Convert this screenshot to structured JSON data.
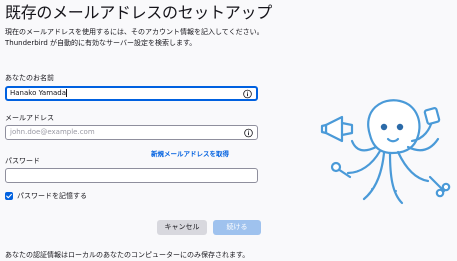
{
  "page": {
    "title": "既存のメールアドレスのセットアップ",
    "description_line1": "現在のメールアドレスを使用するには、そのアカウント情報を記入してください。",
    "description_line2": "Thunderbird が自動的に有効なサーバー設定を検索します。"
  },
  "form": {
    "name_label": "あなたのお名前",
    "name_value": "Hanako Yamada",
    "email_label": "メールアドレス",
    "email_placeholder": "john.doe@example.com",
    "get_new_email_link": "新規メールアドレスを取得",
    "password_label": "パスワード",
    "remember_password_label": "パスワードを記憶する",
    "remember_password_checked": true
  },
  "buttons": {
    "cancel": "キャンセル",
    "continue": "続ける"
  },
  "footer": {
    "note": "あなたの認証情報はローカルのあなたのコンピューターにのみ保存されます。"
  },
  "colors": {
    "accent": "#0061e0",
    "mascot": "#4a9ad8"
  },
  "icons": [
    "info-icon",
    "checkmark-icon",
    "octopus-mascot"
  ]
}
